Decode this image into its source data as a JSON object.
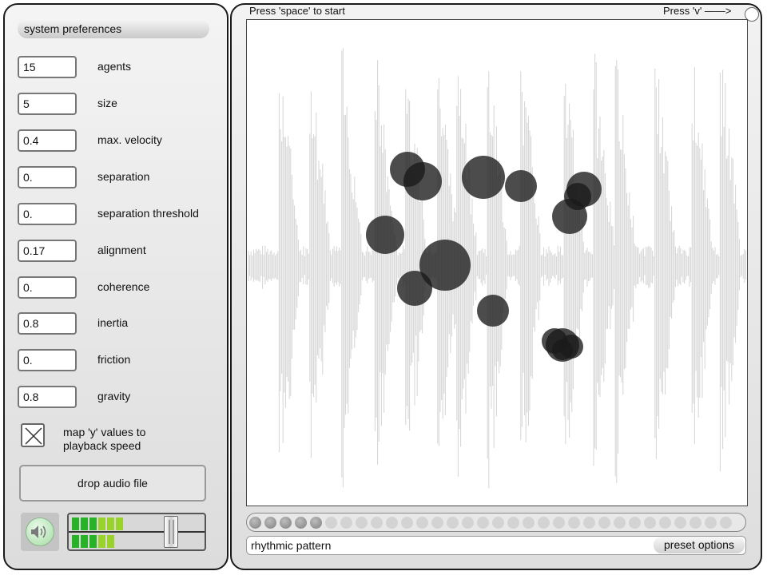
{
  "left_panel": {
    "header": "system preferences",
    "params": [
      {
        "label": "agents",
        "value": "15"
      },
      {
        "label": "size",
        "value": "5"
      },
      {
        "label": "max. velocity",
        "value": "0.4"
      },
      {
        "label": "separation",
        "value": "0."
      },
      {
        "label": "separation threshold",
        "value": "0."
      },
      {
        "label": "alignment",
        "value": "0.17"
      },
      {
        "label": "coherence",
        "value": "0."
      },
      {
        "label": "inertia",
        "value": "0.8"
      },
      {
        "label": "friction",
        "value": "0."
      },
      {
        "label": "gravity",
        "value": "0.8"
      }
    ],
    "checkbox": {
      "label": "map 'y' values to playback speed",
      "checked": true
    },
    "drop_button": "drop audio file",
    "speaker_icon": "speaker-icon",
    "meter": {
      "level_top": 0.45,
      "level_bottom": 0.37,
      "slider": 0.78
    }
  },
  "right_panel": {
    "hint_start": "Press 'space' to start",
    "hint_v": "Press 'v' ——>",
    "sequencer": {
      "total_steps": 32,
      "active_steps": 5
    },
    "pattern_label": "rhythmic pattern",
    "preset_button": "preset options"
  },
  "colors": {
    "waveform": "#d4d4d4",
    "agent": "#1a1a1a",
    "meter_on": "#28b228",
    "meter_mid": "#9ad22c",
    "meter_off": "#7a7a7a"
  }
}
